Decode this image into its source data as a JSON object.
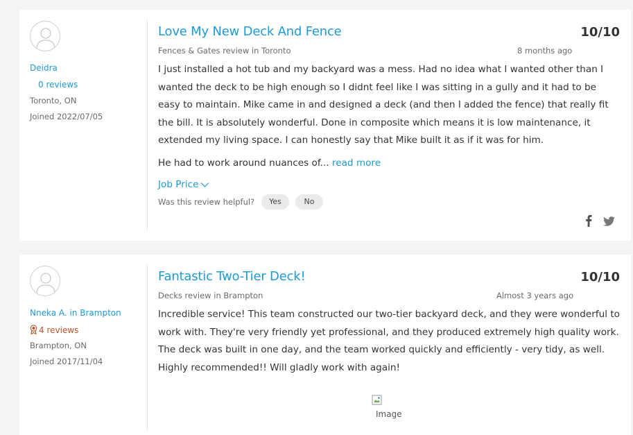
{
  "reviews": [
    {
      "reviewer": {
        "name": "Deidra",
        "reviews": "0 reviews",
        "location": "Toronto, ON",
        "joined": "Joined 2022/07/05"
      },
      "title": "Love My New Deck And Fence",
      "score": "10/10",
      "category": "Fences & Gates review in Toronto",
      "date": "8 months ago",
      "body": "I just installed a hot tub and my backyard was a mess. Had no idea what I wanted other than I wanted the deck to be high enough so I didnt feel like I was sitting in a gully and it had to be easy to maintain. Mike came in and designed a deck (and then I added the fence) that really fit the bill. It is absolutely wonderful. Done in composite which means it is low maintenance, it extended my living space. I can honestly say that Mike built it as if it was for him.",
      "excerpt": "He had to work around nuances of... ",
      "read_more": "read more",
      "job_price": "Job Price",
      "helpful_prompt": "Was this review helpful?",
      "yes": "Yes",
      "no": "No"
    },
    {
      "reviewer": {
        "name": "Nneka A. in Brampton",
        "reviews": "4 reviews",
        "location": "Brampton, ON",
        "joined": "Joined 2017/11/04"
      },
      "title": "Fantastic Two-Tier Deck!",
      "score": "10/10",
      "category": "Decks review in Brampton",
      "date": "Almost 3 years ago",
      "body": "Incredible service! This team constructed our two-tier backyard deck, and they were wonderful to work with. They're very friendly yet professional, and they produced extremely high quality work. The deck was built in one day, and the team worked quickly and efficiently - very tidy, as well. Highly recommended!! Will gladly work with again!",
      "image_alt": "Image"
    }
  ],
  "icons": {
    "avatar": "user-avatar-icon",
    "badge": "reviewer-badge-icon",
    "facebook": "facebook-icon",
    "twitter": "twitter-icon",
    "chevron": "chevron-down-icon"
  },
  "colors": {
    "link": "#1e9ad6",
    "badge": "#c0522a",
    "text": "#333333",
    "muted": "#6a6a6a"
  }
}
